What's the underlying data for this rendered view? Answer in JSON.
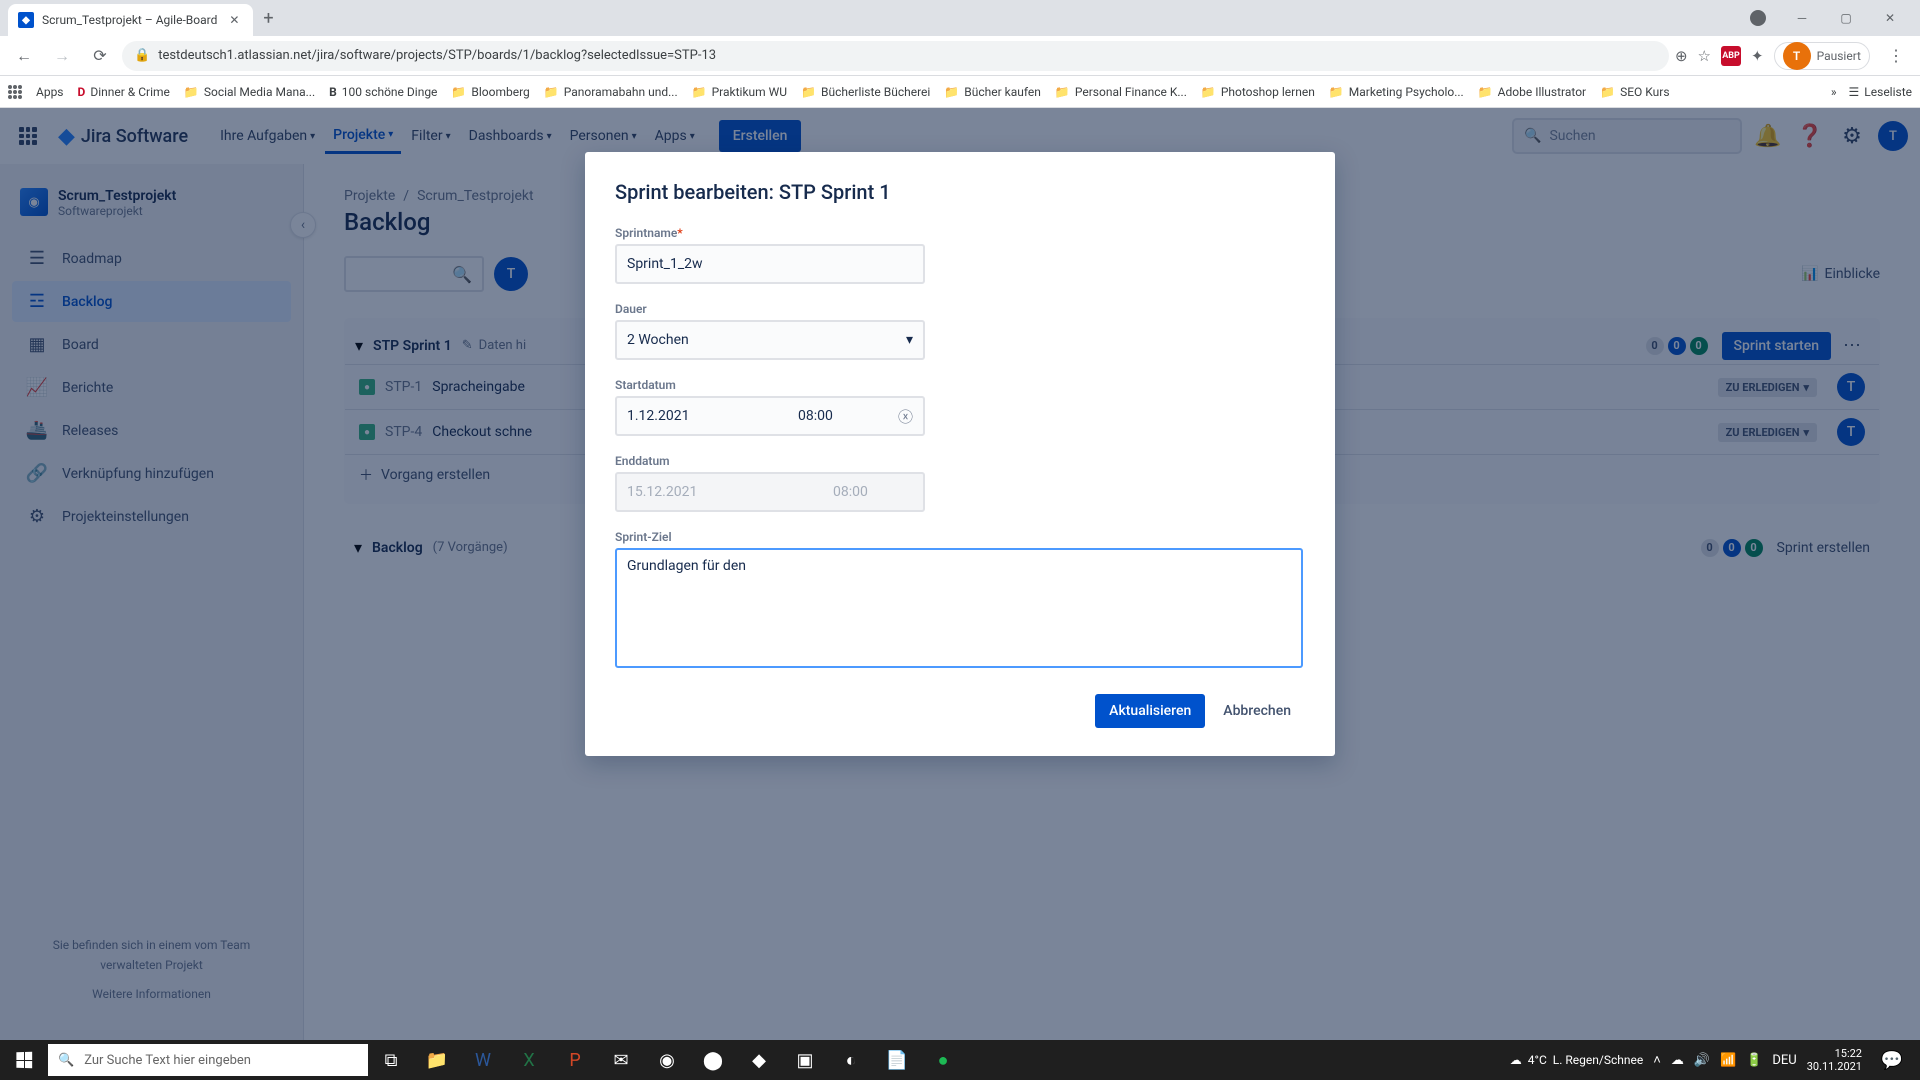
{
  "browser": {
    "tab_title": "Scrum_Testprojekt – Agile-Board",
    "url": "testdeutsch1.atlassian.net/jira/software/projects/STP/boards/1/backlog?selectedIssue=STP-13",
    "pausiert": "Pausiert",
    "apps_label": "Apps",
    "leseliste": "Leseliste",
    "bookmarks": [
      "Dinner & Crime",
      "Social Media Mana...",
      "100 schöne Dinge",
      "Bloomberg",
      "Panoramabahn und...",
      "Praktikum WU",
      "Bücherliste Bücherei",
      "Bücher kaufen",
      "Personal Finance K...",
      "Photoshop lernen",
      "Marketing Psycholo...",
      "Adobe Illustrator",
      "SEO Kurs"
    ]
  },
  "jira": {
    "product": "Jira Software",
    "nav": {
      "work": "Ihre Aufgaben",
      "projects": "Projekte",
      "filters": "Filter",
      "dashboards": "Dashboards",
      "people": "Personen",
      "apps": "Apps"
    },
    "create": "Erstellen",
    "search_placeholder": "Suchen",
    "user_initial": "T"
  },
  "sidebar": {
    "project_name": "Scrum_Testprojekt",
    "project_type": "Softwareprojekt",
    "items": [
      {
        "label": "Roadmap"
      },
      {
        "label": "Backlog"
      },
      {
        "label": "Board"
      },
      {
        "label": "Berichte"
      },
      {
        "label": "Releases"
      },
      {
        "label": "Verknüpfung hinzufügen"
      },
      {
        "label": "Projekteinstellungen"
      }
    ],
    "footer1": "Sie befinden sich in einem vom Team verwalteten Projekt",
    "footer2": "Weitere Informationen"
  },
  "page": {
    "crumbs": {
      "a": "Projekte",
      "b": "Scrum_Testprojekt"
    },
    "title": "Backlog",
    "insights": "Einblicke",
    "user_initial": "T"
  },
  "sprint": {
    "name": "STP Sprint 1",
    "add_date": "Daten hi",
    "badges": {
      "g": "0",
      "b": "0",
      "gn": "0"
    },
    "start": "Sprint starten",
    "status": "ZU ERLEDIGEN",
    "issues": [
      {
        "key": "STP-1",
        "title": "Spracheingabe"
      },
      {
        "key": "STP-4",
        "title": "Checkout schne"
      }
    ],
    "create_issue": "Vorgang erstellen"
  },
  "backlog": {
    "name": "Backlog",
    "count": "(7 Vorgänge)",
    "badges": {
      "g": "0",
      "b": "0",
      "gn": "0"
    },
    "create": "Sprint erstellen"
  },
  "modal": {
    "title": "Sprint bearbeiten: STP Sprint 1",
    "labels": {
      "name": "Sprintname",
      "duration": "Dauer",
      "start": "Startdatum",
      "end": "Enddatum",
      "goal": "Sprint-Ziel"
    },
    "name_value": "Sprint_1_2w",
    "duration_value": "2 Wochen",
    "start_date": "1.12.2021",
    "start_time": "08:00",
    "end_date": "15.12.2021",
    "end_time": "08:00",
    "goal_value": "Grundlagen für den ",
    "action_update": "Aktualisieren",
    "action_cancel": "Abbrechen"
  },
  "taskbar": {
    "search_placeholder": "Zur Suche Text hier eingeben",
    "weather_temp": "4°C",
    "weather_text": "L. Regen/Schnee",
    "lang": "DEU",
    "time": "15:22",
    "date": "30.11.2021"
  }
}
